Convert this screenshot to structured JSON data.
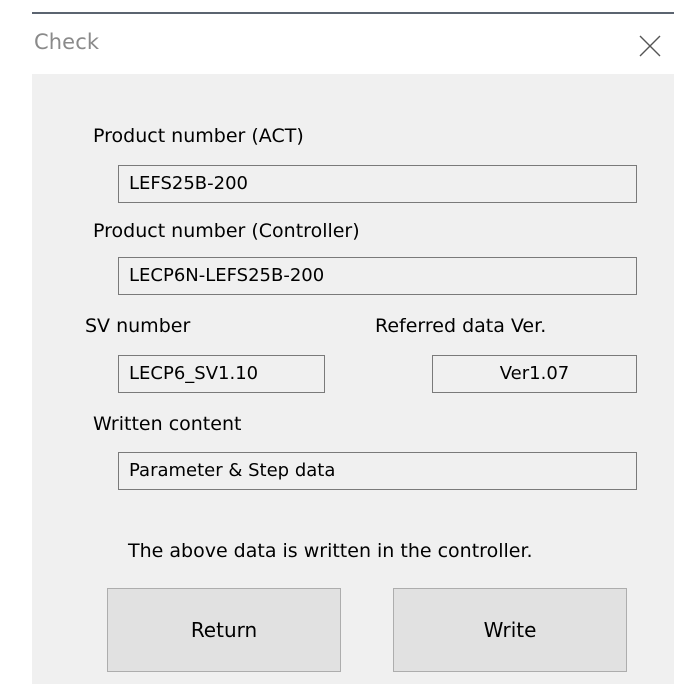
{
  "window": {
    "title": "Check",
    "close_icon": "close-icon"
  },
  "fields": {
    "product_act": {
      "label": "Product number (ACT)",
      "value": "LEFS25B-200"
    },
    "product_controller": {
      "label": "Product number (Controller)",
      "value": "LECP6N-LEFS25B-200"
    },
    "sv_number": {
      "label": "SV number",
      "value": "LECP6_SV1.10"
    },
    "referred_data_ver": {
      "label": "Referred data Ver.",
      "value": "Ver1.07"
    },
    "written_content": {
      "label": "Written content",
      "value": "Parameter & Step data"
    }
  },
  "message": "The above data is written in the controller.",
  "buttons": {
    "return_label": "Return",
    "write_label": "Write"
  },
  "colors": {
    "dialog_background": "#f0f0f0",
    "button_background": "#e1e1e1",
    "titlebar_border": "#5b6470"
  }
}
